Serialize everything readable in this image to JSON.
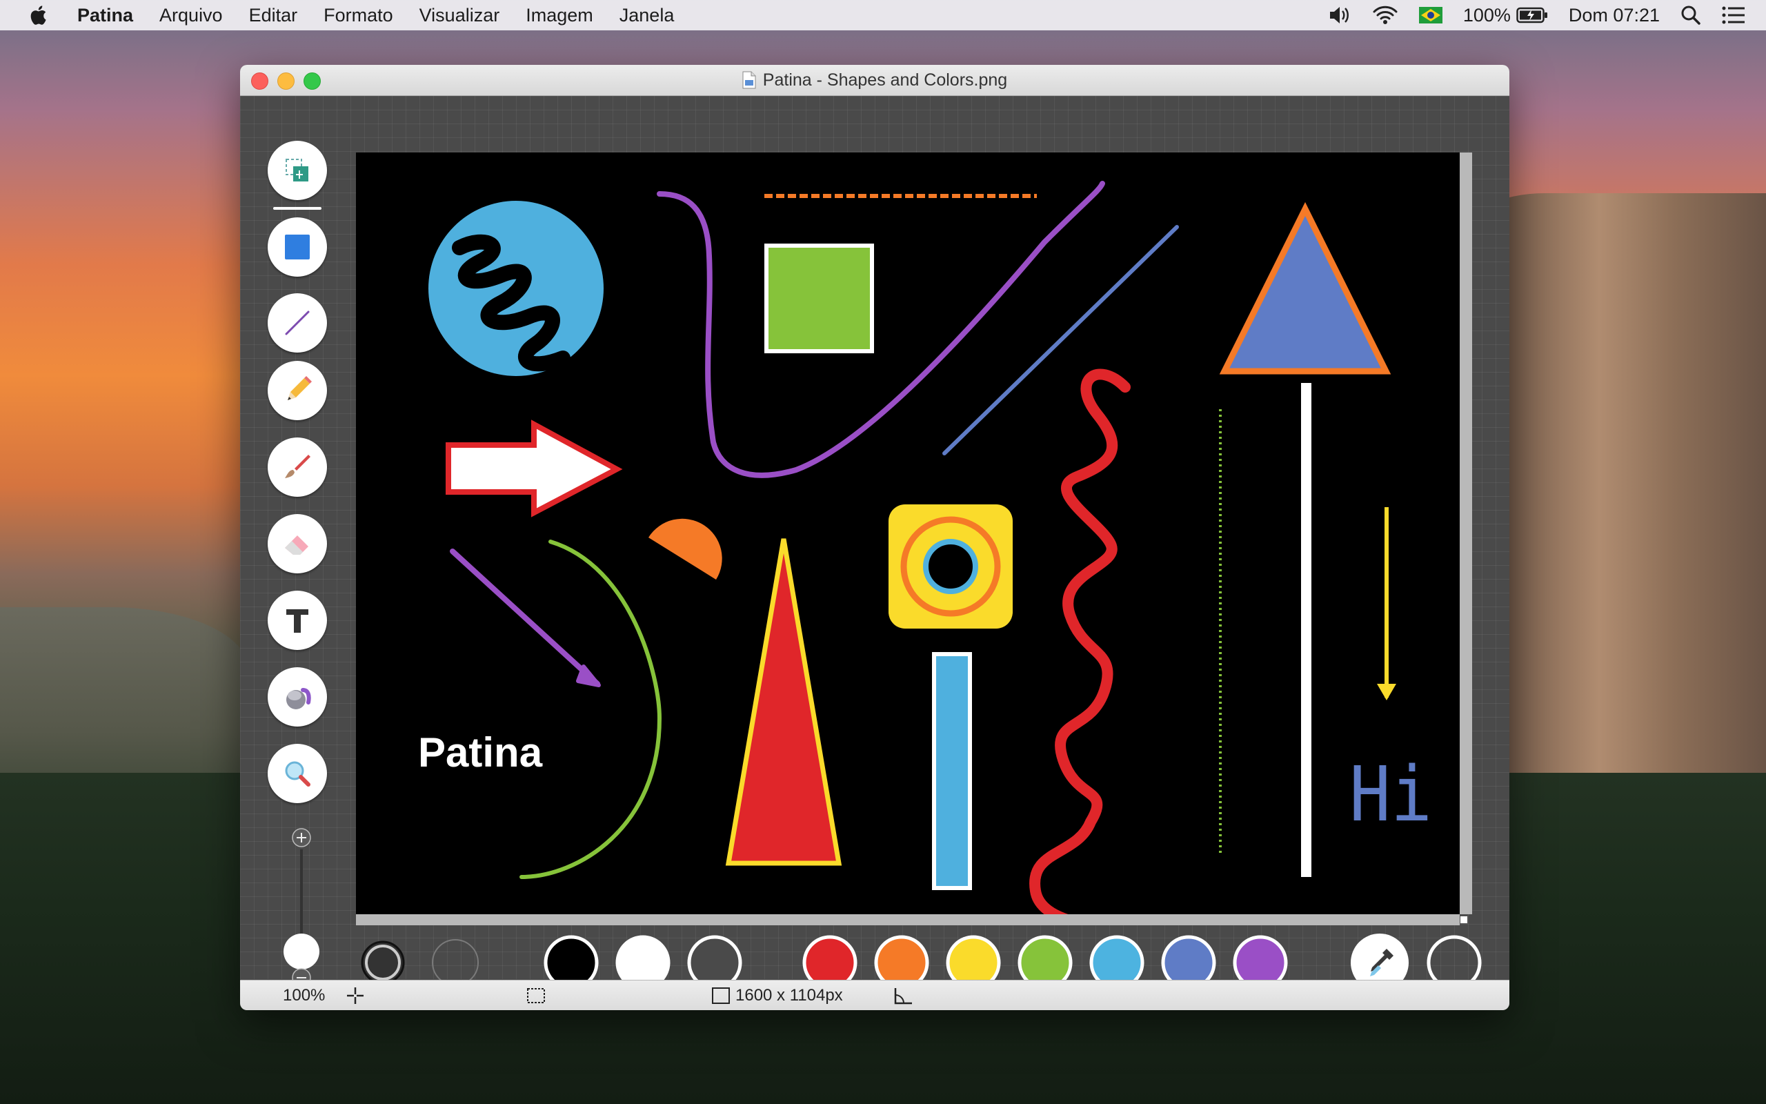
{
  "menubar": {
    "app_name": "Patina",
    "menus": [
      "Arquivo",
      "Editar",
      "Formato",
      "Visualizar",
      "Imagem",
      "Janela"
    ],
    "battery": "100%",
    "clock": "Dom 07:21"
  },
  "window": {
    "title": "Patina - Shapes and Colors.png"
  },
  "tools": [
    {
      "name": "selection",
      "icon": "selection-icon"
    },
    {
      "name": "shape",
      "icon": "square-shape-icon"
    },
    {
      "name": "line",
      "icon": "line-icon"
    },
    {
      "name": "pencil",
      "icon": "pencil-icon"
    },
    {
      "name": "brush",
      "icon": "brush-icon"
    },
    {
      "name": "eraser",
      "icon": "eraser-icon"
    },
    {
      "name": "text",
      "icon": "text-icon"
    },
    {
      "name": "fill",
      "icon": "paint-bucket-icon"
    },
    {
      "name": "zoom",
      "icon": "magnifier-icon"
    }
  ],
  "canvas_text": {
    "patina": "Patina",
    "hi": "Hi"
  },
  "palette": {
    "colors": [
      "#000000",
      "#ffffff",
      "#4a4a4a",
      "#e0262a",
      "#f57a27",
      "#fadb2b",
      "#86c33a",
      "#4db3e0",
      "#5f7cc6",
      "#9a4fc6"
    ],
    "eyedropper_icon": "eyedropper-icon"
  },
  "statusbar": {
    "zoom": "100%",
    "dimensions": "1600 x 1104px"
  }
}
